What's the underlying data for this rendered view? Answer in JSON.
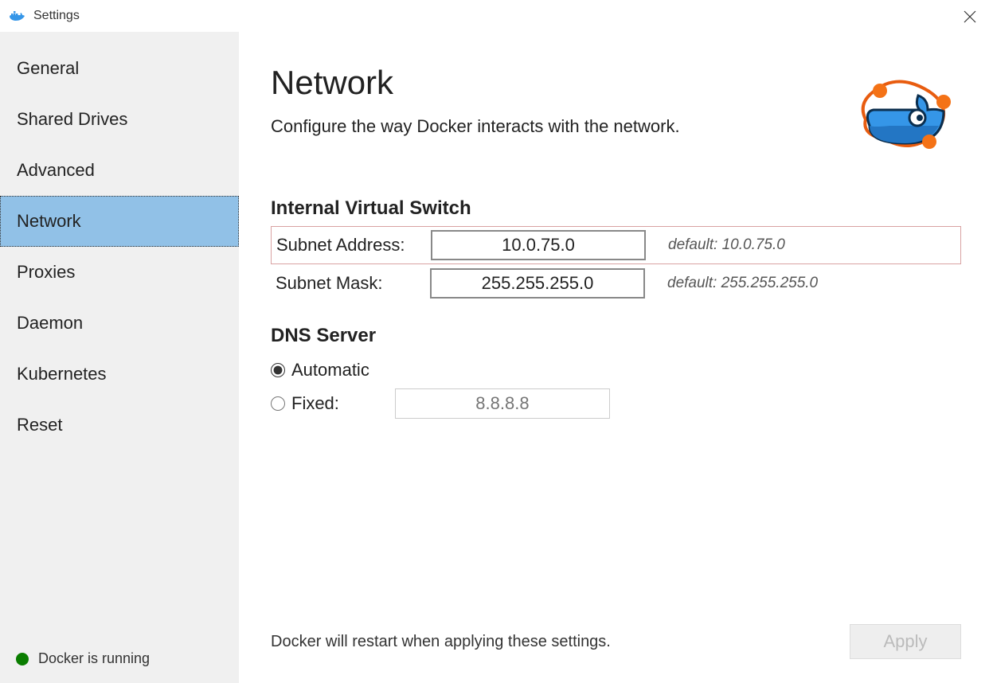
{
  "window": {
    "title": "Settings"
  },
  "sidebar": {
    "items": [
      "General",
      "Shared Drives",
      "Advanced",
      "Network",
      "Proxies",
      "Daemon",
      "Kubernetes",
      "Reset"
    ],
    "active_index": 3,
    "status": "Docker is running"
  },
  "main": {
    "title": "Network",
    "subtitle": "Configure the way Docker interacts with the network.",
    "section_switch": {
      "heading": "Internal Virtual Switch",
      "subnet_address_label": "Subnet Address:",
      "subnet_address_value": "10.0.75.0",
      "subnet_address_hint": "default: 10.0.75.0",
      "subnet_mask_label": "Subnet Mask:",
      "subnet_mask_value": "255.255.255.0",
      "subnet_mask_hint": "default: 255.255.255.0"
    },
    "section_dns": {
      "heading": "DNS Server",
      "automatic_label": "Automatic",
      "fixed_label": "Fixed:",
      "fixed_placeholder": "8.8.8.8",
      "selected": "automatic"
    },
    "footer": {
      "text": "Docker will restart when applying these settings.",
      "apply_label": "Apply"
    }
  }
}
